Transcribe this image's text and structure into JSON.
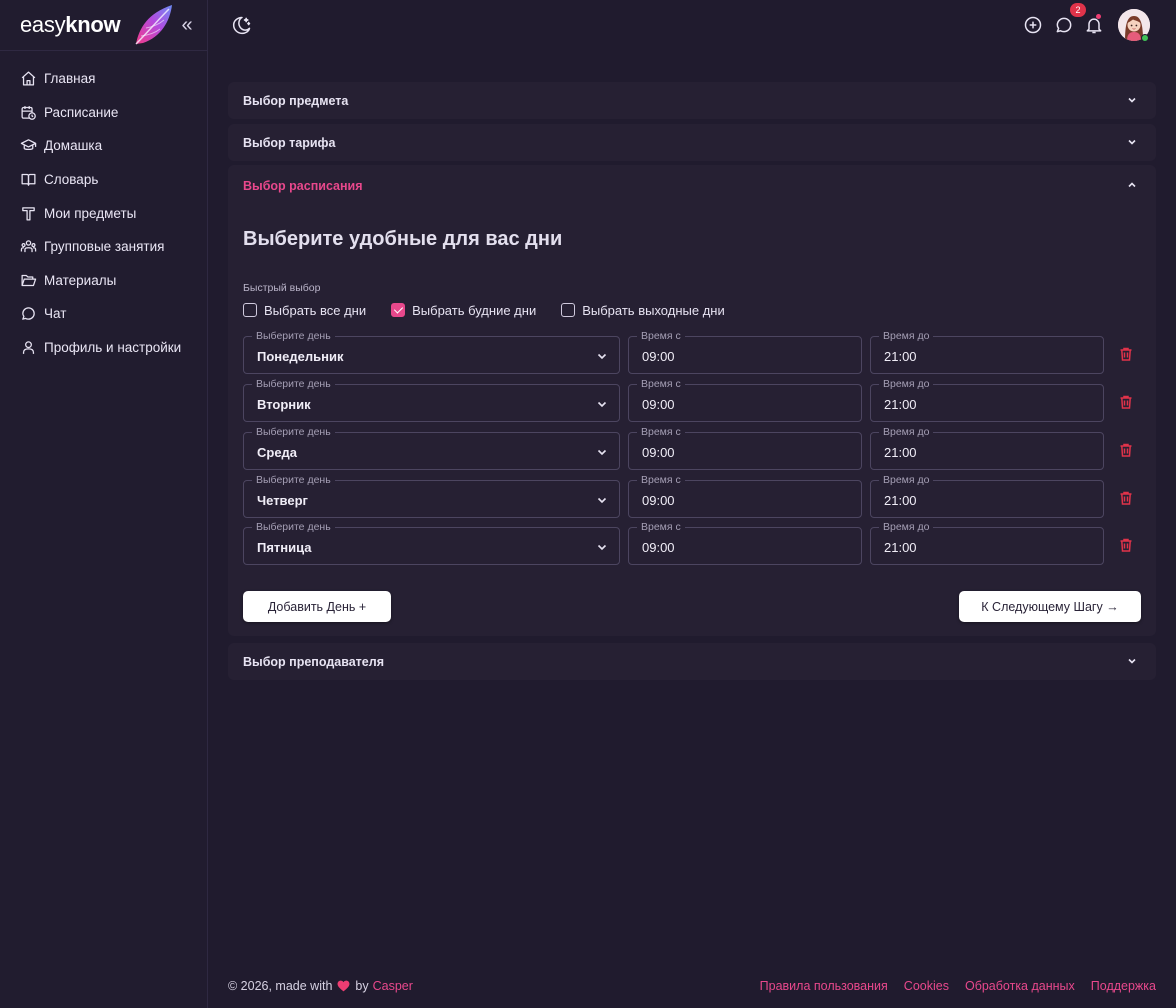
{
  "brand": {
    "name_light": "easy",
    "name_bold": "know",
    "collapse_icon": "«"
  },
  "sidebar": {
    "items": [
      {
        "label": "Главная",
        "icon": "home-icon"
      },
      {
        "label": "Расписание",
        "icon": "calendar-clock-icon"
      },
      {
        "label": "Домашка",
        "icon": "graduation-cap-icon"
      },
      {
        "label": "Словарь",
        "icon": "book-open-icon"
      },
      {
        "label": "Мои предметы",
        "icon": "typography-icon"
      },
      {
        "label": "Групповые занятия",
        "icon": "users-icon"
      },
      {
        "label": "Материалы",
        "icon": "folder-open-icon"
      },
      {
        "label": "Чат",
        "icon": "chat-bubble-icon"
      },
      {
        "label": "Профиль и настройки",
        "icon": "user-icon"
      }
    ]
  },
  "header": {
    "notifications_badge": "2",
    "icons": [
      "moon-icon",
      "plus-circle-icon",
      "chat-icon",
      "bell-icon",
      "avatar"
    ]
  },
  "accordion": {
    "subject": "Выбор предмета",
    "tariff": "Выбор тарифа",
    "schedule": "Выбор расписания",
    "teacher": "Выбор преподавателя"
  },
  "schedule": {
    "title": "Выберите удобные для вас дни",
    "quick_label": "Быстрый выбор",
    "quick": {
      "all": "Выбрать все дни",
      "weekdays": "Выбрать будние дни",
      "weekends": "Выбрать выходные дни"
    },
    "quick_state": {
      "all": false,
      "weekdays": true,
      "weekends": false
    },
    "labels": {
      "day": "Выберите день",
      "from": "Время с",
      "to": "Время до"
    },
    "rows": [
      {
        "day": "Понедельник",
        "from": "09:00",
        "to": "21:00"
      },
      {
        "day": "Вторник",
        "from": "09:00",
        "to": "21:00"
      },
      {
        "day": "Среда",
        "from": "09:00",
        "to": "21:00"
      },
      {
        "day": "Четверг",
        "from": "09:00",
        "to": "21:00"
      },
      {
        "day": "Пятница",
        "from": "09:00",
        "to": "21:00"
      }
    ],
    "add_button": "Добавить День +",
    "next_button": "К Следующему Шагу →"
  },
  "footer": {
    "copyright": "© 2026, made with",
    "by": "by",
    "author": "Casper",
    "links": [
      "Правила пользования",
      "Cookies",
      "Обработка данных",
      "Поддержка"
    ]
  },
  "colors": {
    "accent": "#e8488c",
    "background": "#201b2e",
    "card": "#262033",
    "danger": "#e0334a"
  }
}
